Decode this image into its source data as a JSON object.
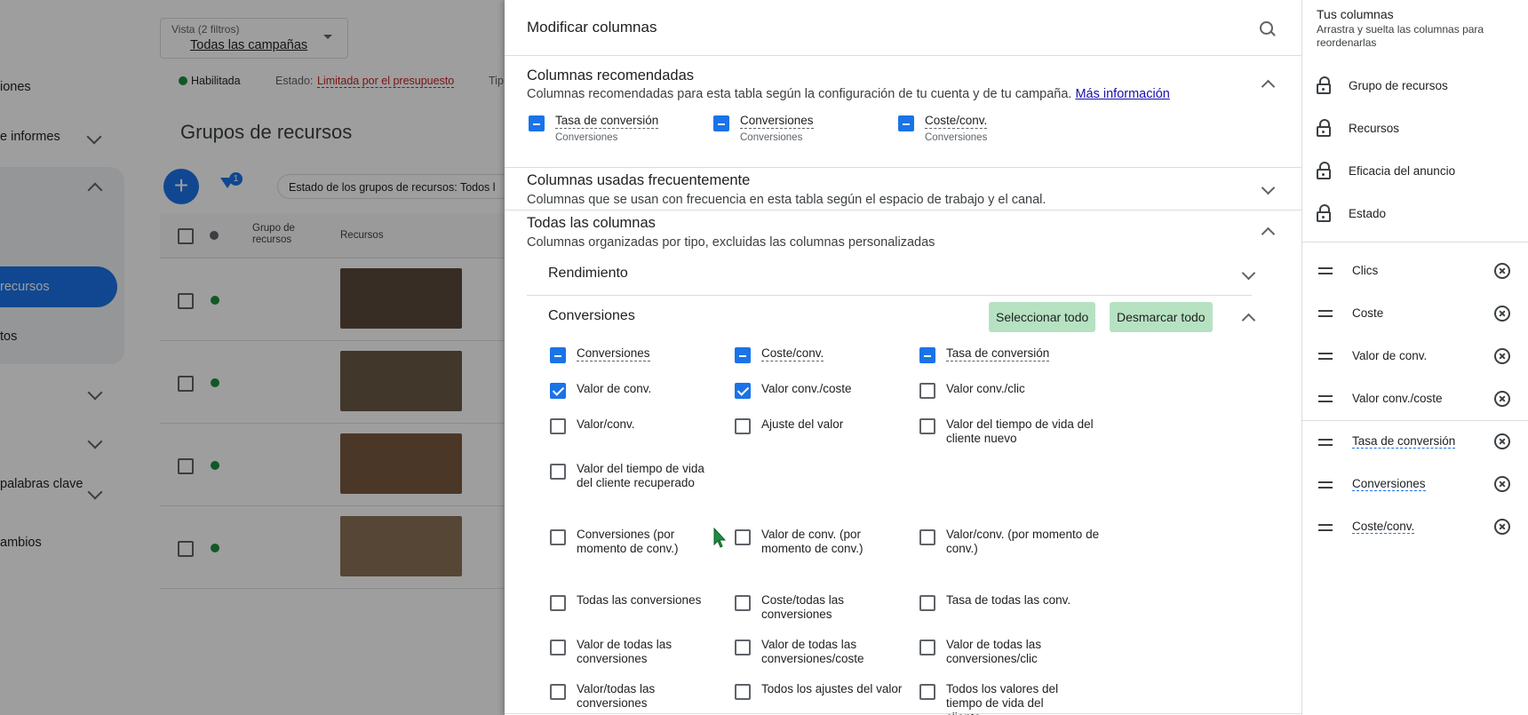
{
  "background": {
    "nav": {
      "items": [
        "iones",
        "e informes",
        "recursos",
        "tos",
        "palabras clave",
        "ambios"
      ]
    },
    "view": {
      "label": "Vista (2 filtros)",
      "value": "Todas las campañas"
    },
    "status": {
      "enabled": "Habilitada",
      "state_label": "Estado:",
      "state_value": "Limitada por el presupuesto",
      "tip": "Tip"
    },
    "page_title": "Grupos de recursos",
    "filter_count": "1",
    "filter_text": "Estado de los grupos de recursos: Todos l",
    "table_headers": {
      "group": "Grupo de recursos",
      "assets": "Recursos"
    }
  },
  "panel": {
    "title": "Modificar columnas",
    "recommended": {
      "title": "Columnas recomendadas",
      "desc": "Columnas recomendadas para esta tabla según la configuración de tu cuenta y de tu campaña.",
      "link": "Más información",
      "items": [
        {
          "label": "Tasa de conversión",
          "sub": "Conversiones"
        },
        {
          "label": "Conversiones",
          "sub": "Conversiones"
        },
        {
          "label": "Coste/conv.",
          "sub": "Conversiones"
        }
      ]
    },
    "frequent": {
      "title": "Columnas usadas frecuentemente",
      "desc": "Columnas que se usan con frecuencia en esta tabla según el espacio de trabajo y el canal."
    },
    "all": {
      "title": "Todas las columnas",
      "desc": "Columnas organizadas por tipo, excluidas las columnas personalizadas"
    },
    "performance": {
      "title": "Rendimiento"
    },
    "conversions": {
      "title": "Conversiones",
      "select_all": "Seleccionar todo",
      "deselect_all": "Desmarcar todo",
      "rows": [
        [
          {
            "label": "Conversiones",
            "state": "ind"
          },
          {
            "label": "Coste/conv.",
            "state": "ind"
          },
          {
            "label": "Tasa de conversión",
            "state": "ind"
          }
        ],
        [
          {
            "label": "Valor de conv.",
            "state": "checked"
          },
          {
            "label": "Valor conv./coste",
            "state": "checked"
          },
          {
            "label": "Valor conv./clic",
            "state": "none"
          }
        ],
        [
          {
            "label": "Valor/conv.",
            "state": "none"
          },
          {
            "label": "Ajuste del valor",
            "state": "none"
          },
          {
            "label": "Valor del tiempo de vida del cliente nuevo",
            "state": "none"
          }
        ],
        [
          {
            "label": "Valor del tiempo de vida del cliente recuperado",
            "state": "none"
          }
        ],
        [
          {
            "label": "Conversiones (por momento de conv.)",
            "state": "none"
          },
          {
            "label": "Valor de conv. (por momento de conv.)",
            "state": "none"
          },
          {
            "label": "Valor/conv. (por momento de conv.)",
            "state": "none"
          }
        ],
        [
          {
            "label": "Todas las conversiones",
            "state": "none"
          },
          {
            "label": "Coste/todas las conversiones",
            "state": "none"
          },
          {
            "label": "Tasa de todas las conv.",
            "state": "none"
          }
        ],
        [
          {
            "label": "Valor de todas las conversiones",
            "state": "none"
          },
          {
            "label": "Valor de todas las conversiones/coste",
            "state": "none"
          },
          {
            "label": "Valor de todas las conversiones/clic",
            "state": "none"
          }
        ],
        [
          {
            "label": "Valor/todas las conversiones",
            "state": "none"
          },
          {
            "label": "Todos los ajustes del valor",
            "state": "none"
          },
          {
            "label": "Todos los valores del tiempo de vida del cliente",
            "state": "none"
          }
        ]
      ]
    }
  },
  "your_columns": {
    "title": "Tus columnas",
    "desc": "Arrastra y suelta las columnas para reordenarlas",
    "locked": [
      "Grupo de recursos",
      "Recursos",
      "Eficacia del anuncio",
      "Estado"
    ],
    "movable": [
      "Clics",
      "Coste",
      "Valor de conv.",
      "Valor conv./coste",
      "Tasa de conversión",
      "Conversiones",
      "Coste/conv."
    ]
  }
}
